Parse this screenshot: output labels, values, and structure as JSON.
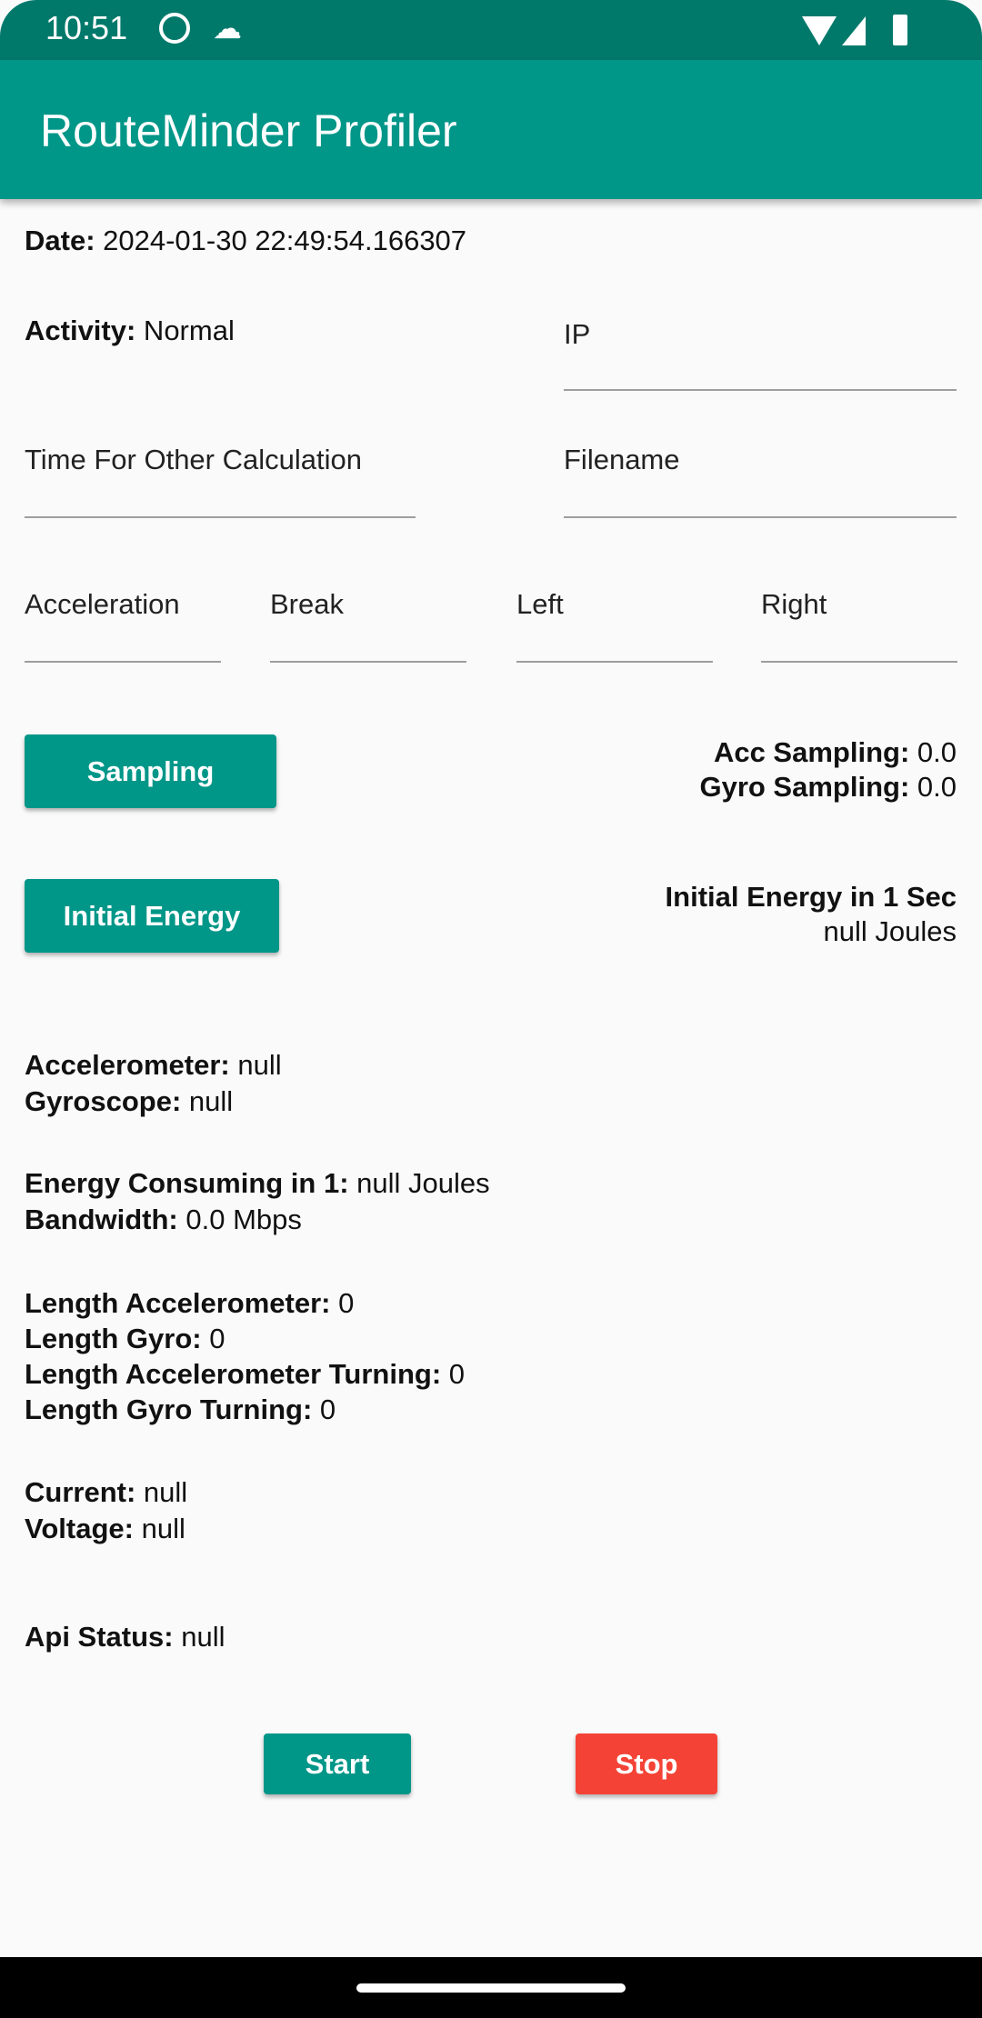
{
  "status_bar": {
    "time": "10:51"
  },
  "app_bar": {
    "title": "RouteMinder Profiler"
  },
  "date": {
    "label": "Date:",
    "value": " 2024-01-30 22:49:54.166307"
  },
  "activity": {
    "label": "Activity:",
    "value": " Normal"
  },
  "fields": {
    "ip": "IP",
    "time_other": "Time For Other Calculation",
    "filename": "Filename",
    "acceleration": "Acceleration",
    "break": "Break",
    "left": "Left",
    "right": "Right"
  },
  "sampling": {
    "button": "Sampling",
    "acc_label": "Acc Sampling:",
    "acc_value": " 0.0",
    "gyro_label": "Gyro Sampling:",
    "gyro_value": " 0.0"
  },
  "initial_energy": {
    "button": "Initial Energy",
    "label": "Initial Energy in 1 Sec",
    "value": "null Joules"
  },
  "sensors": {
    "acc_label": "Accelerometer:",
    "acc_value": " null",
    "gyro_label": "Gyroscope:",
    "gyro_value": " null"
  },
  "energy": {
    "label": "Energy Consuming in 1:",
    "value": " null Joules",
    "bw_label": "Bandwidth:",
    "bw_value": " 0.0 Mbps"
  },
  "lengths": {
    "acc_label": "Length Accelerometer:",
    "acc_value": " 0",
    "gyro_label": "Length Gyro:",
    "gyro_value": " 0",
    "acc_turn_label": "Length Accelerometer Turning:",
    "acc_turn_value": " 0",
    "gyro_turn_label": "Length Gyro Turning:",
    "gyro_turn_value": " 0"
  },
  "power": {
    "current_label": "Current:",
    "current_value": " null",
    "voltage_label": "Voltage:",
    "voltage_value": " null"
  },
  "api": {
    "label": "Api Status:",
    "value": " null"
  },
  "actions": {
    "start": "Start",
    "stop": "Stop"
  },
  "colors": {
    "primary": "#009688",
    "primary_dark": "#00796b",
    "stop": "#f44336"
  }
}
